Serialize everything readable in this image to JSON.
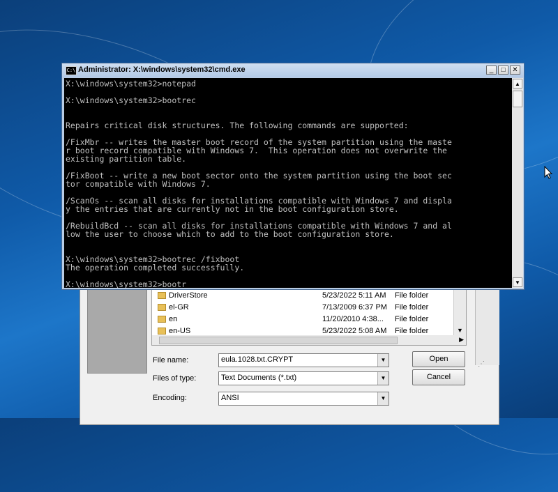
{
  "cmd": {
    "title": "Administrator: X:\\windows\\system32\\cmd.exe",
    "app_icon": "C:\\",
    "controls": {
      "minimize": "_",
      "maximize": "□",
      "close": "✕"
    },
    "lines": [
      "X:\\windows\\system32>notepad",
      "",
      "X:\\windows\\system32>bootrec",
      "",
      "",
      "Repairs critical disk structures. The following commands are supported:",
      "",
      "/FixMbr -- writes the master boot record of the system partition using the maste",
      "r boot record compatible with Windows 7.  This operation does not overwrite the",
      "existing partition table.",
      "",
      "/FixBoot -- write a new boot sector onto the system partition using the boot sec",
      "tor compatible with Windows 7.",
      "",
      "/ScanOs -- scan all disks for installations compatible with Windows 7 and displa",
      "y the entries that are currently not in the boot configuration store.",
      "",
      "/RebuildBcd -- scan all disks for installations compatible with Windows 7 and al",
      "low the user to choose which to add to the boot configuration store.",
      "",
      "",
      "X:\\windows\\system32>bootrec /fixboot",
      "The operation completed successfully.",
      "",
      "X:\\windows\\system32>bootr"
    ]
  },
  "open_dialog": {
    "files": [
      {
        "name": "DriverStore",
        "date": "5/23/2022 5:11 AM",
        "type": "File folder"
      },
      {
        "name": "el-GR",
        "date": "7/13/2009 6:37 PM",
        "type": "File folder"
      },
      {
        "name": "en",
        "date": "11/20/2010 4:38...",
        "type": "File folder"
      },
      {
        "name": "en-US",
        "date": "5/23/2022 5:08 AM",
        "type": "File folder"
      }
    ],
    "file_name_label": "File name:",
    "file_name_value": "eula.1028.txt.CRYPT",
    "files_of_type_label": "Files of type:",
    "files_of_type_value": "Text Documents (*.txt)",
    "encoding_label": "Encoding:",
    "encoding_value": "ANSI",
    "open_button": "Open",
    "cancel_button": "Cancel"
  },
  "icons": [
    "cmd-app-icon",
    "folder-icon",
    "mouse-pointer-icon",
    "resize-grip-icon"
  ],
  "colors": {
    "console_bg": "#000000",
    "console_text": "#c0c0c0",
    "title_bar": "#b9cde5",
    "folder": "#e8c058"
  }
}
